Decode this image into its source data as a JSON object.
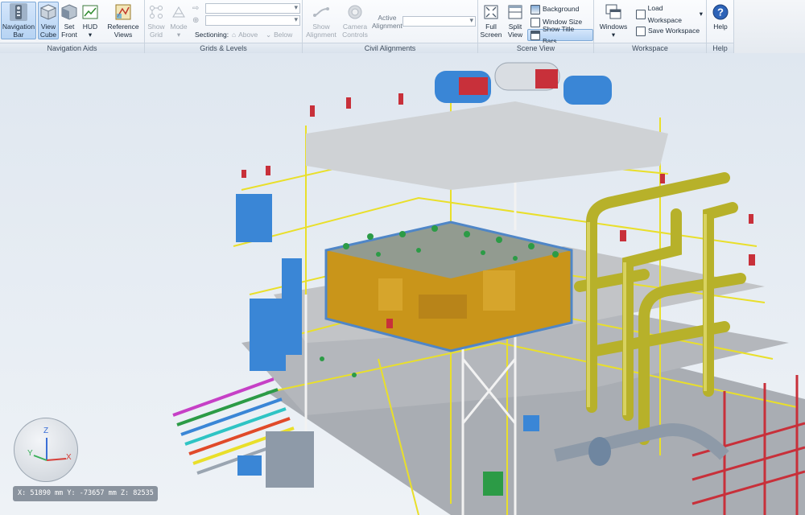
{
  "ribbon": {
    "groups": {
      "navigation_aids": {
        "label": "Navigation Aids",
        "navigation_bar_line1": "Navigation",
        "navigation_bar_line2": "Bar",
        "view_cube_line1": "View",
        "view_cube_line2": "Cube",
        "set_front_line1": "Set",
        "set_front_line2": "Front",
        "hud_label": "HUD",
        "reference_views_line1": "Reference",
        "reference_views_line2": "Views"
      },
      "grids_levels": {
        "label": "Grids & Levels",
        "show_grid_line1": "Show",
        "show_grid_line2": "Grid",
        "mode_label": "Mode",
        "sectioning_label": "Sectioning:",
        "above_label": "Above",
        "below_label": "Below"
      },
      "civil_alignments": {
        "label": "Civil Alignments",
        "show_alignment_line1": "Show",
        "show_alignment_line2": "Alignment",
        "camera_controls_line1": "Camera",
        "camera_controls_line2": "Controls",
        "active_alignment_line1": "Active",
        "active_alignment_line2": "Alignment"
      },
      "scene_view": {
        "label": "Scene View",
        "full_screen_line1": "Full",
        "full_screen_line2": "Screen",
        "split_view_line1": "Split",
        "split_view_line2": "View",
        "background_label": "Background",
        "window_size_label": "Window Size",
        "show_title_bars_label": "Show Title Bars"
      },
      "workspace": {
        "label": "Workspace",
        "windows_label": "Windows",
        "load_workspace_label": "Load Workspace",
        "save_workspace_label": "Save Workspace"
      },
      "help": {
        "label": "Help",
        "help_label": "Help"
      }
    }
  },
  "viewport": {
    "axes": {
      "x": "X",
      "y": "Y",
      "z": "Z"
    },
    "coordinates": "X: 51890 mm  Y: -73657 mm  Z: 82535 mm"
  },
  "colors": {
    "structure_yellow": "#e9df2a",
    "pipe_olive": "#b7b12a",
    "equipment_blue": "#3a86d6",
    "vessel_red": "#c8303a",
    "deck_grey": "#a9adb3",
    "valve_green": "#2c9b46"
  }
}
